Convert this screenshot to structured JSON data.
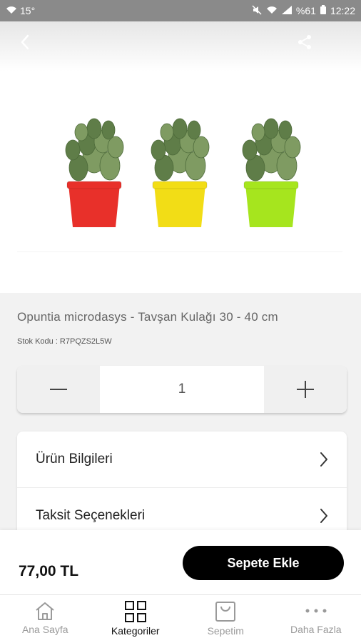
{
  "status_bar": {
    "temperature": "15°",
    "battery": "%61",
    "time": "12:22"
  },
  "product": {
    "title": "Opuntia microdasys - Tavşan Kulağı 30 - 40 cm",
    "stock_code": "Stok Kodu : R7PQZS2L5W",
    "quantity": "1",
    "price": "77,00 TL",
    "pot_colors": [
      "#e8302a",
      "#f2dd16",
      "#a6e51e"
    ]
  },
  "info_rows": [
    {
      "label": "Ürün Bilgileri"
    },
    {
      "label": "Taksit Seçenekleri"
    }
  ],
  "cart": {
    "add_button": "Sepete Ekle"
  },
  "nav": {
    "items": [
      {
        "label": "Ana Sayfa",
        "icon": "home-icon"
      },
      {
        "label": "Kategoriler",
        "icon": "grid-icon"
      },
      {
        "label": "Sepetim",
        "icon": "bag-icon"
      },
      {
        "label": "Daha Fazla",
        "icon": "more-icon"
      }
    ],
    "active": "Kategoriler"
  }
}
